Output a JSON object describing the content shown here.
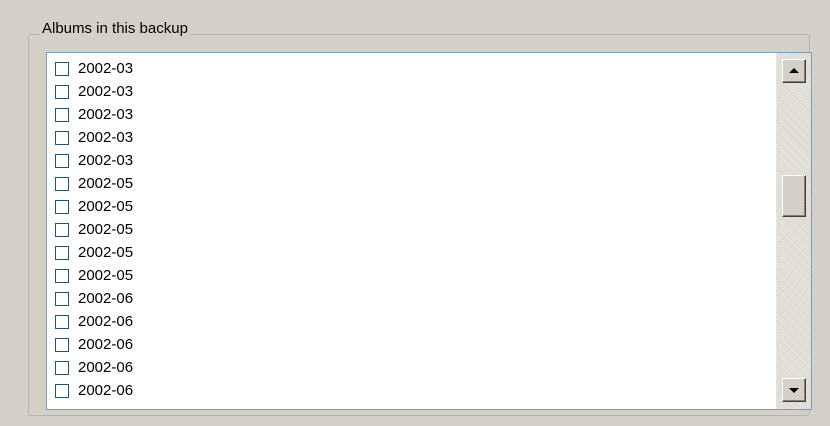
{
  "groupbox": {
    "title": "Albums in this backup"
  },
  "albums": [
    {
      "date": "2002-03",
      "checked": false
    },
    {
      "date": "2002-03",
      "checked": false
    },
    {
      "date": "2002-03",
      "checked": false
    },
    {
      "date": "2002-03",
      "checked": false
    },
    {
      "date": "2002-03",
      "checked": false
    },
    {
      "date": "2002-05",
      "checked": false
    },
    {
      "date": "2002-05",
      "checked": false
    },
    {
      "date": "2002-05",
      "checked": false
    },
    {
      "date": "2002-05",
      "checked": false
    },
    {
      "date": "2002-05",
      "checked": false
    },
    {
      "date": "2002-06",
      "checked": false
    },
    {
      "date": "2002-06",
      "checked": false
    },
    {
      "date": "2002-06",
      "checked": false
    },
    {
      "date": "2002-06",
      "checked": false
    },
    {
      "date": "2002-06",
      "checked": false
    }
  ],
  "scrollbar": {
    "up_icon": "up-arrow-icon",
    "down_icon": "down-arrow-icon"
  }
}
